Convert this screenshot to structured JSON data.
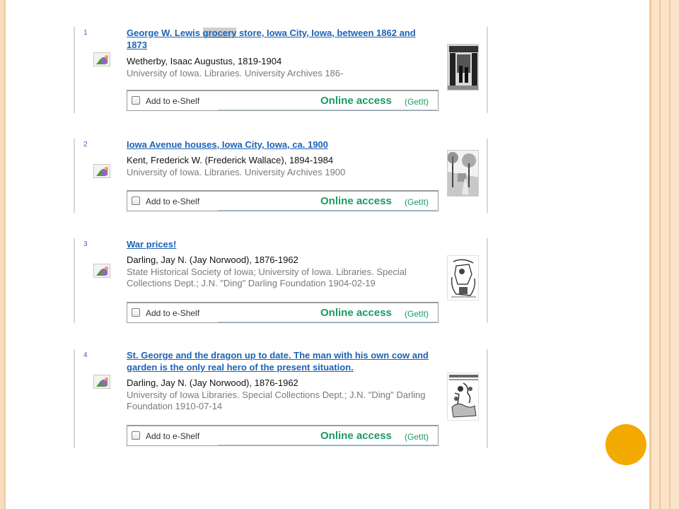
{
  "records": [
    {
      "number": "1",
      "title": {
        "before": "George W. Lewis ",
        "highlight": "grocery",
        "after": " store, Iowa City, Iowa, between 1862 and 1873"
      },
      "author": "Wetherby, Isaac Augustus, 1819-1904",
      "source": "University of Iowa. Libraries. University Archives 186-",
      "shelf_label": "Add to e-Shelf",
      "access_label": "Online access",
      "getit_label": "(GetIt)",
      "icon": "image-type-icon",
      "thumbnail": "storefront-photo-thumbnail"
    },
    {
      "number": "2",
      "title": {
        "before": "Iowa Avenue houses, Iowa City, Iowa, ca. 1900",
        "highlight": "",
        "after": ""
      },
      "author": "Kent, Frederick W. (Frederick Wallace), 1894-1984",
      "source": "University of Iowa. Libraries. University Archives 1900",
      "shelf_label": "Add to e-Shelf",
      "access_label": "Online access",
      "getit_label": "(GetIt)",
      "icon": "image-type-icon",
      "thumbnail": "street-photo-thumbnail"
    },
    {
      "number": "3",
      "title": {
        "before": "War prices!",
        "highlight": "",
        "after": ""
      },
      "author": "Darling, Jay N. (Jay Norwood), 1876-1962",
      "source": "State Historical Society of Iowa; University of Iowa. Libraries. Special Collections Dept.; J.N. \"Ding\" Darling Foundation 1904-02-19",
      "shelf_label": "Add to e-Shelf",
      "access_label": "Online access",
      "getit_label": "(GetIt)",
      "icon": "image-type-icon",
      "thumbnail": "cartoon-thumbnail"
    },
    {
      "number": "4",
      "title": {
        "before": "St. George and the dragon up to date. The man with his own cow and garden is the only real hero of the present situation.",
        "highlight": "",
        "after": ""
      },
      "author": "Darling, Jay N. (Jay Norwood), 1876-1962",
      "source": "University of Iowa Libraries. Special Collections Dept.; J.N. \"Ding\" Darling Foundation 1910-07-14",
      "shelf_label": "Add to e-Shelf",
      "access_label": "Online access",
      "getit_label": "(GetIt)",
      "icon": "image-type-icon",
      "thumbnail": "cartoon-thumbnail"
    }
  ],
  "colors": {
    "link": "#1c63b5",
    "online_access": "#1a9a63",
    "accent_circle": "#f2a900",
    "frame": "#f8dcc0"
  }
}
